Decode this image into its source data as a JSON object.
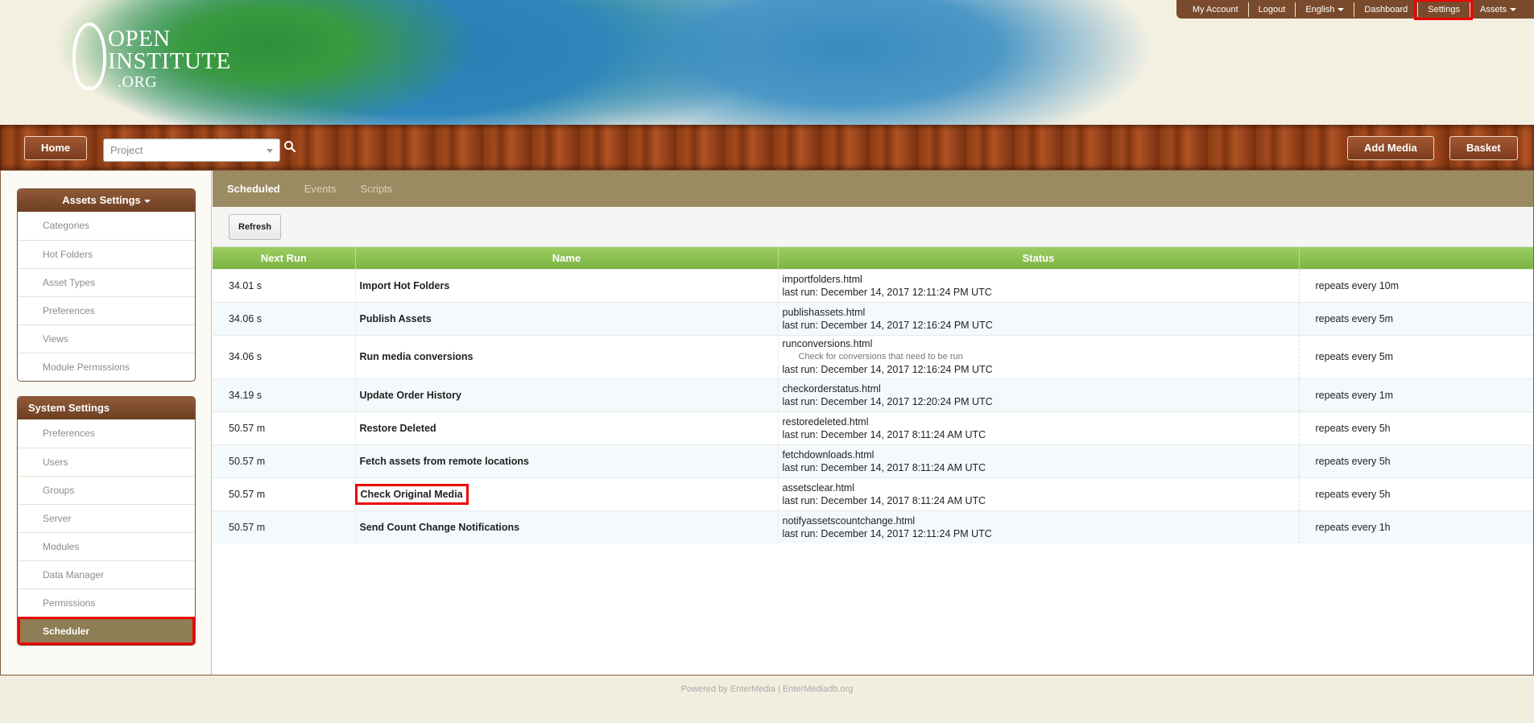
{
  "logo": {
    "line1": "OPEN",
    "line2": "INSTITUTE",
    "line3": ".ORG"
  },
  "topnav": [
    {
      "label": "My Account"
    },
    {
      "label": "Logout"
    },
    {
      "label": "English"
    },
    {
      "label": "Dashboard"
    },
    {
      "label": "Settings"
    },
    {
      "label": "Assets"
    }
  ],
  "woodbar": {
    "home_label": "Home",
    "project_placeholder": "Project",
    "add_media_label": "Add Media",
    "basket_label": "Basket"
  },
  "sidebar": {
    "assets_settings": {
      "title": "Assets Settings",
      "items": [
        "Categories",
        "Hot Folders",
        "Asset Types",
        "Preferences",
        "Views",
        "Module Permissions"
      ]
    },
    "system_settings": {
      "title": "System Settings",
      "items": [
        "Preferences",
        "Users",
        "Groups",
        "Server",
        "Modules",
        "Data Manager",
        "Permissions",
        "Scheduler"
      ],
      "active": "Scheduler"
    }
  },
  "tabs": [
    {
      "label": "Scheduled",
      "active": true
    },
    {
      "label": "Events",
      "active": false
    },
    {
      "label": "Scripts",
      "active": false
    }
  ],
  "toolbar": {
    "refresh_label": "Refresh"
  },
  "table": {
    "headers": [
      "Next Run",
      "Name",
      "Status",
      ""
    ],
    "rows": [
      {
        "next_run": "34.01 s",
        "name": "Import Hot Folders",
        "script": "importfolders.html",
        "desc": "",
        "last_run": "last run: December 14, 2017 12:11:24 PM UTC",
        "repeat": "repeats every 10m"
      },
      {
        "next_run": "34.06 s",
        "name": "Publish Assets",
        "script": "publishassets.html",
        "desc": "",
        "last_run": "last run: December 14, 2017 12:16:24 PM UTC",
        "repeat": "repeats every 5m"
      },
      {
        "next_run": "34.06 s",
        "name": "Run media conversions",
        "script": "runconversions.html",
        "desc": "Check for conversions that need to be run",
        "last_run": "last run: December 14, 2017 12:16:24 PM UTC",
        "repeat": "repeats every 5m"
      },
      {
        "next_run": "34.19 s",
        "name": "Update Order History",
        "script": "checkorderstatus.html",
        "desc": "",
        "last_run": "last run: December 14, 2017 12:20:24 PM UTC",
        "repeat": "repeats every 1m"
      },
      {
        "next_run": "50.57 m",
        "name": "Restore Deleted",
        "script": "restoredeleted.html",
        "desc": "",
        "last_run": "last run: December 14, 2017 8:11:24 AM UTC",
        "repeat": "repeats every 5h"
      },
      {
        "next_run": "50.57 m",
        "name": "Fetch assets from remote locations",
        "script": "fetchdownloads.html",
        "desc": "",
        "last_run": "last run: December 14, 2017 8:11:24 AM UTC",
        "repeat": "repeats every 5h"
      },
      {
        "next_run": "50.57 m",
        "name": "Check Original Media",
        "script": "assetsclear.html",
        "desc": "",
        "last_run": "last run: December 14, 2017 8:11:24 AM UTC",
        "repeat": "repeats every 5h"
      },
      {
        "next_run": "50.57 m",
        "name": "Send Count Change Notifications",
        "script": "notifyassetscountchange.html",
        "desc": "",
        "last_run": "last run: December 14, 2017 12:11:24 PM UTC",
        "repeat": "repeats every 1h"
      }
    ]
  },
  "footer": {
    "text": "Powered by EnterMedia | EnterMediadb.org"
  }
}
